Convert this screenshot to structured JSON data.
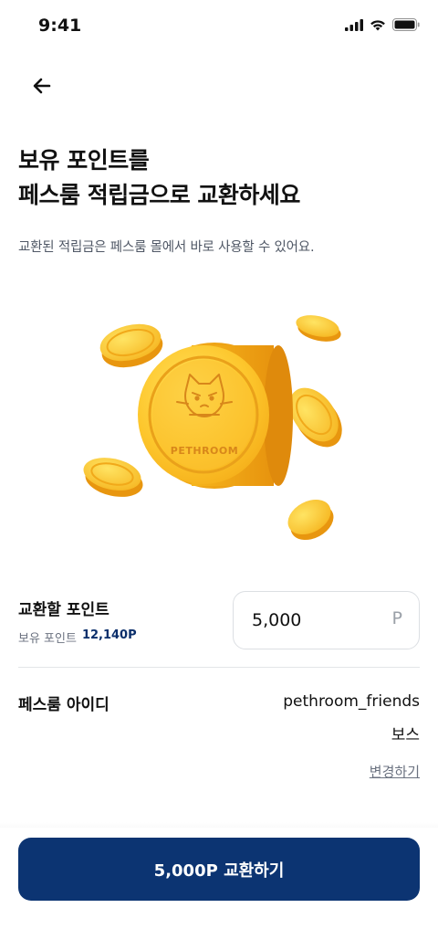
{
  "status_bar": {
    "time": "9:41",
    "icons": [
      "cellular-signal-icon",
      "wifi-icon",
      "battery-icon"
    ]
  },
  "header": {
    "back_icon": "arrow-left-icon"
  },
  "title": {
    "line1": "보유 포인트를",
    "line2": "페스룸 적립금으로 교환하세요"
  },
  "subtitle": "교환된 적립금은 페스룸 몰에서 바로 사용할 수 있어요.",
  "illustration": {
    "coin_text": "PETHROOM",
    "icon": "pethroom-cat-coin-icon"
  },
  "exchange_points": {
    "label": "교환할 포인트",
    "owned_label": "보유 포인트",
    "owned_value": "12,140P",
    "input_value": "5,000",
    "unit": "P"
  },
  "account": {
    "label": "페스룸 아이디",
    "id": "pethroom_friends",
    "name": "보스",
    "change_label": "변경하기"
  },
  "cta": {
    "label": "5,000P 교환하기"
  },
  "colors": {
    "brand_navy": "#0c3472",
    "owned_points_text": "#0b2f6b",
    "coin_gold": "#fbc72c",
    "coin_emboss": "#d88a18"
  }
}
